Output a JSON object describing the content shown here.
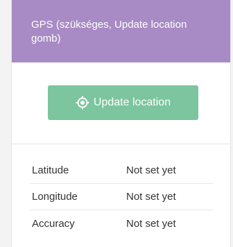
{
  "header": {
    "title": "GPS (szükséges, Update location gomb)"
  },
  "action": {
    "button_label": "Update location",
    "button_icon": "target-icon"
  },
  "location": {
    "rows": [
      {
        "label": "Latitude",
        "value": "Not set yet"
      },
      {
        "label": "Longitude",
        "value": "Not set yet"
      },
      {
        "label": "Accuracy",
        "value": "Not set yet"
      }
    ]
  },
  "colors": {
    "header_bg": "#a88ac4",
    "button_bg": "#7cc59e"
  }
}
